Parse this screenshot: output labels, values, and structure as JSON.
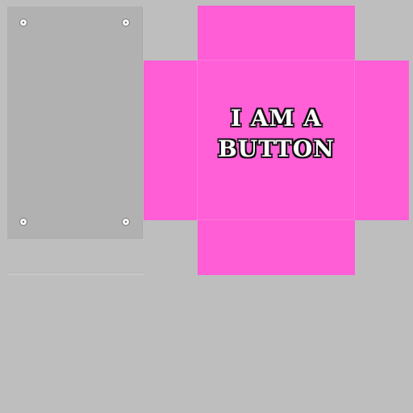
{
  "button": {
    "label_line1": "I AM A",
    "label_line2": "BUTTON",
    "color": "#ff5ed6",
    "text_color": "#ffffff",
    "outline_color": "#111111"
  },
  "base": {
    "color": "#b1b1b1",
    "screw_color": "#f4f4f4"
  },
  "background_color": "#bebebe"
}
